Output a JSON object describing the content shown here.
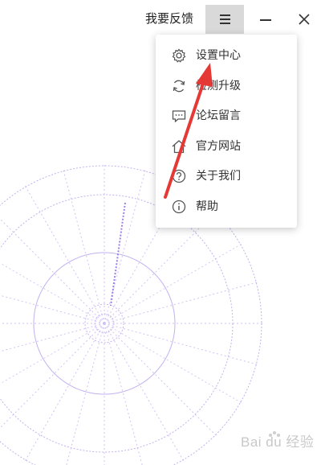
{
  "titlebar": {
    "feedback_label": "我要反馈",
    "menu_icon": "hamburger-icon",
    "minimize_icon": "minimize-icon",
    "close_icon": "close-icon"
  },
  "menu": {
    "items": [
      {
        "label": "设置中心",
        "icon": "gear-icon"
      },
      {
        "label": "检测升级",
        "icon": "refresh-icon"
      },
      {
        "label": "论坛留言",
        "icon": "comment-icon"
      },
      {
        "label": "官方网站",
        "icon": "home-icon"
      },
      {
        "label": "关于我们",
        "icon": "help-circle-icon"
      },
      {
        "label": "帮助",
        "icon": "info-icon"
      }
    ]
  },
  "colors": {
    "menu_button_bg": "#d9d9d9",
    "radar": "#a98ee8",
    "arrow": "#e53935",
    "text": "#333333"
  },
  "watermark": {
    "text": "Bai du 经验"
  }
}
